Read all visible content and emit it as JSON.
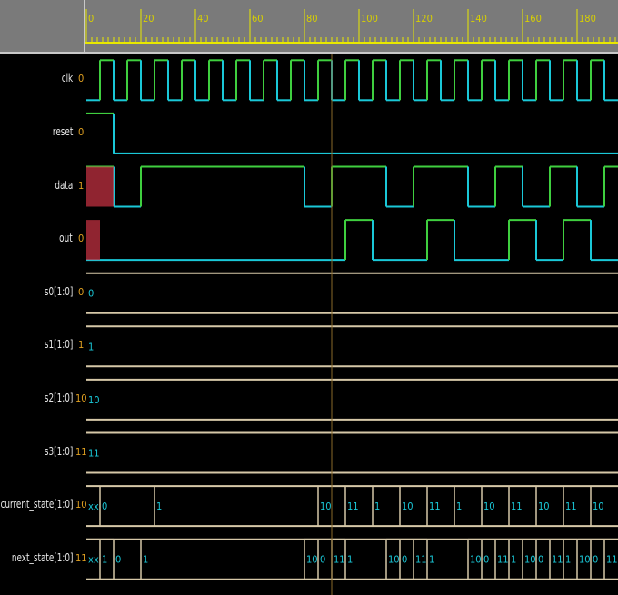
{
  "ruler": {
    "ticks": [
      "0",
      "20",
      "40",
      "60",
      "80",
      "100",
      "120",
      "140",
      "160",
      "180"
    ]
  },
  "signals": [
    {
      "name": "clk",
      "value": "0"
    },
    {
      "name": "reset",
      "value": "0"
    },
    {
      "name": "data",
      "value": "1"
    },
    {
      "name": "out",
      "value": "0"
    },
    {
      "name": "s0[1:0]",
      "value": "0"
    },
    {
      "name": "s1[1:0]",
      "value": "1"
    },
    {
      "name": "s2[1:0]",
      "value": "10"
    },
    {
      "name": "s3[1:0]",
      "value": "11"
    },
    {
      "name": "current_state[1:0]",
      "value": "10"
    },
    {
      "name": "next_state[1:0]",
      "value": "11"
    }
  ],
  "bus_segments": {
    "s0": [
      {
        "t0": 0,
        "t1": 195,
        "label": "0"
      }
    ],
    "s1": [
      {
        "t0": 0,
        "t1": 195,
        "label": "1"
      }
    ],
    "s2": [
      {
        "t0": 0,
        "t1": 195,
        "label": "10"
      }
    ],
    "s3": [
      {
        "t0": 0,
        "t1": 195,
        "label": "11"
      }
    ],
    "current_state": [
      {
        "t0": 0,
        "t1": 5,
        "label": "xx"
      },
      {
        "t0": 5,
        "t1": 25,
        "label": "0"
      },
      {
        "t0": 25,
        "t1": 85,
        "label": "1"
      },
      {
        "t0": 85,
        "t1": 95,
        "label": "10"
      },
      {
        "t0": 95,
        "t1": 105,
        "label": "11"
      },
      {
        "t0": 105,
        "t1": 115,
        "label": "1"
      },
      {
        "t0": 115,
        "t1": 125,
        "label": "10"
      },
      {
        "t0": 125,
        "t1": 135,
        "label": "11"
      },
      {
        "t0": 135,
        "t1": 145,
        "label": "1"
      },
      {
        "t0": 145,
        "t1": 155,
        "label": "10"
      },
      {
        "t0": 155,
        "t1": 165,
        "label": "11"
      },
      {
        "t0": 165,
        "t1": 175,
        "label": "10"
      },
      {
        "t0": 175,
        "t1": 185,
        "label": "11"
      },
      {
        "t0": 185,
        "t1": 195,
        "label": "10"
      }
    ],
    "next_state": [
      {
        "t0": 0,
        "t1": 5,
        "label": "xx"
      },
      {
        "t0": 5,
        "t1": 10,
        "label": "1"
      },
      {
        "t0": 10,
        "t1": 20,
        "label": "0"
      },
      {
        "t0": 20,
        "t1": 80,
        "label": "1"
      },
      {
        "t0": 80,
        "t1": 85,
        "label": "10"
      },
      {
        "t0": 85,
        "t1": 90,
        "label": "0"
      },
      {
        "t0": 90,
        "t1": 95,
        "label": "11"
      },
      {
        "t0": 95,
        "t1": 110,
        "label": "1"
      },
      {
        "t0": 110,
        "t1": 115,
        "label": "10"
      },
      {
        "t0": 115,
        "t1": 120,
        "label": "0"
      },
      {
        "t0": 120,
        "t1": 125,
        "label": "11"
      },
      {
        "t0": 125,
        "t1": 140,
        "label": "1"
      },
      {
        "t0": 140,
        "t1": 145,
        "label": "10"
      },
      {
        "t0": 145,
        "t1": 150,
        "label": "0"
      },
      {
        "t0": 150,
        "t1": 155,
        "label": "11"
      },
      {
        "t0": 155,
        "t1": 160,
        "label": "1"
      },
      {
        "t0": 160,
        "t1": 165,
        "label": "10"
      },
      {
        "t0": 165,
        "t1": 170,
        "label": "0"
      },
      {
        "t0": 170,
        "t1": 175,
        "label": "11"
      },
      {
        "t0": 175,
        "t1": 180,
        "label": "1"
      },
      {
        "t0": 180,
        "t1": 185,
        "label": "10"
      },
      {
        "t0": 185,
        "t1": 190,
        "label": "0"
      },
      {
        "t0": 190,
        "t1": 195,
        "label": "11"
      }
    ]
  },
  "digital_waves": {
    "clk_period": 10,
    "clk_first_rise": 5,
    "reset_transitions": [
      [
        0,
        1
      ],
      [
        10,
        0
      ]
    ],
    "data_transitions": [
      [
        0,
        1
      ],
      [
        10,
        0
      ],
      [
        20,
        1
      ],
      [
        80,
        0
      ],
      [
        90,
        1
      ],
      [
        110,
        0
      ],
      [
        120,
        1
      ],
      [
        140,
        0
      ],
      [
        150,
        1
      ],
      [
        160,
        0
      ],
      [
        170,
        1
      ],
      [
        180,
        0
      ],
      [
        190,
        1
      ]
    ],
    "out_transitions": [
      [
        0,
        0
      ],
      [
        95,
        1
      ],
      [
        105,
        0
      ],
      [
        125,
        1
      ],
      [
        135,
        0
      ],
      [
        155,
        1
      ],
      [
        165,
        0
      ],
      [
        175,
        1
      ],
      [
        185,
        0
      ]
    ],
    "unknown_regions": [
      {
        "signal": "data",
        "t0": 0,
        "t1": 10
      },
      {
        "signal": "out",
        "t0": 0,
        "t1": 5
      }
    ]
  },
  "cursor_time": 90,
  "colors": {
    "high": "#3fcf3f",
    "low": "#1ac8d8",
    "bus": "#d6c8a8",
    "bus_text": "#1ac8d8",
    "value_text": "#e0a020",
    "name_text": "#e6e6e6",
    "ruler_line": "#e8e800",
    "ruler_text": "#d8d000",
    "cursor": "#8a6a2a",
    "unknown": "#c03040"
  }
}
